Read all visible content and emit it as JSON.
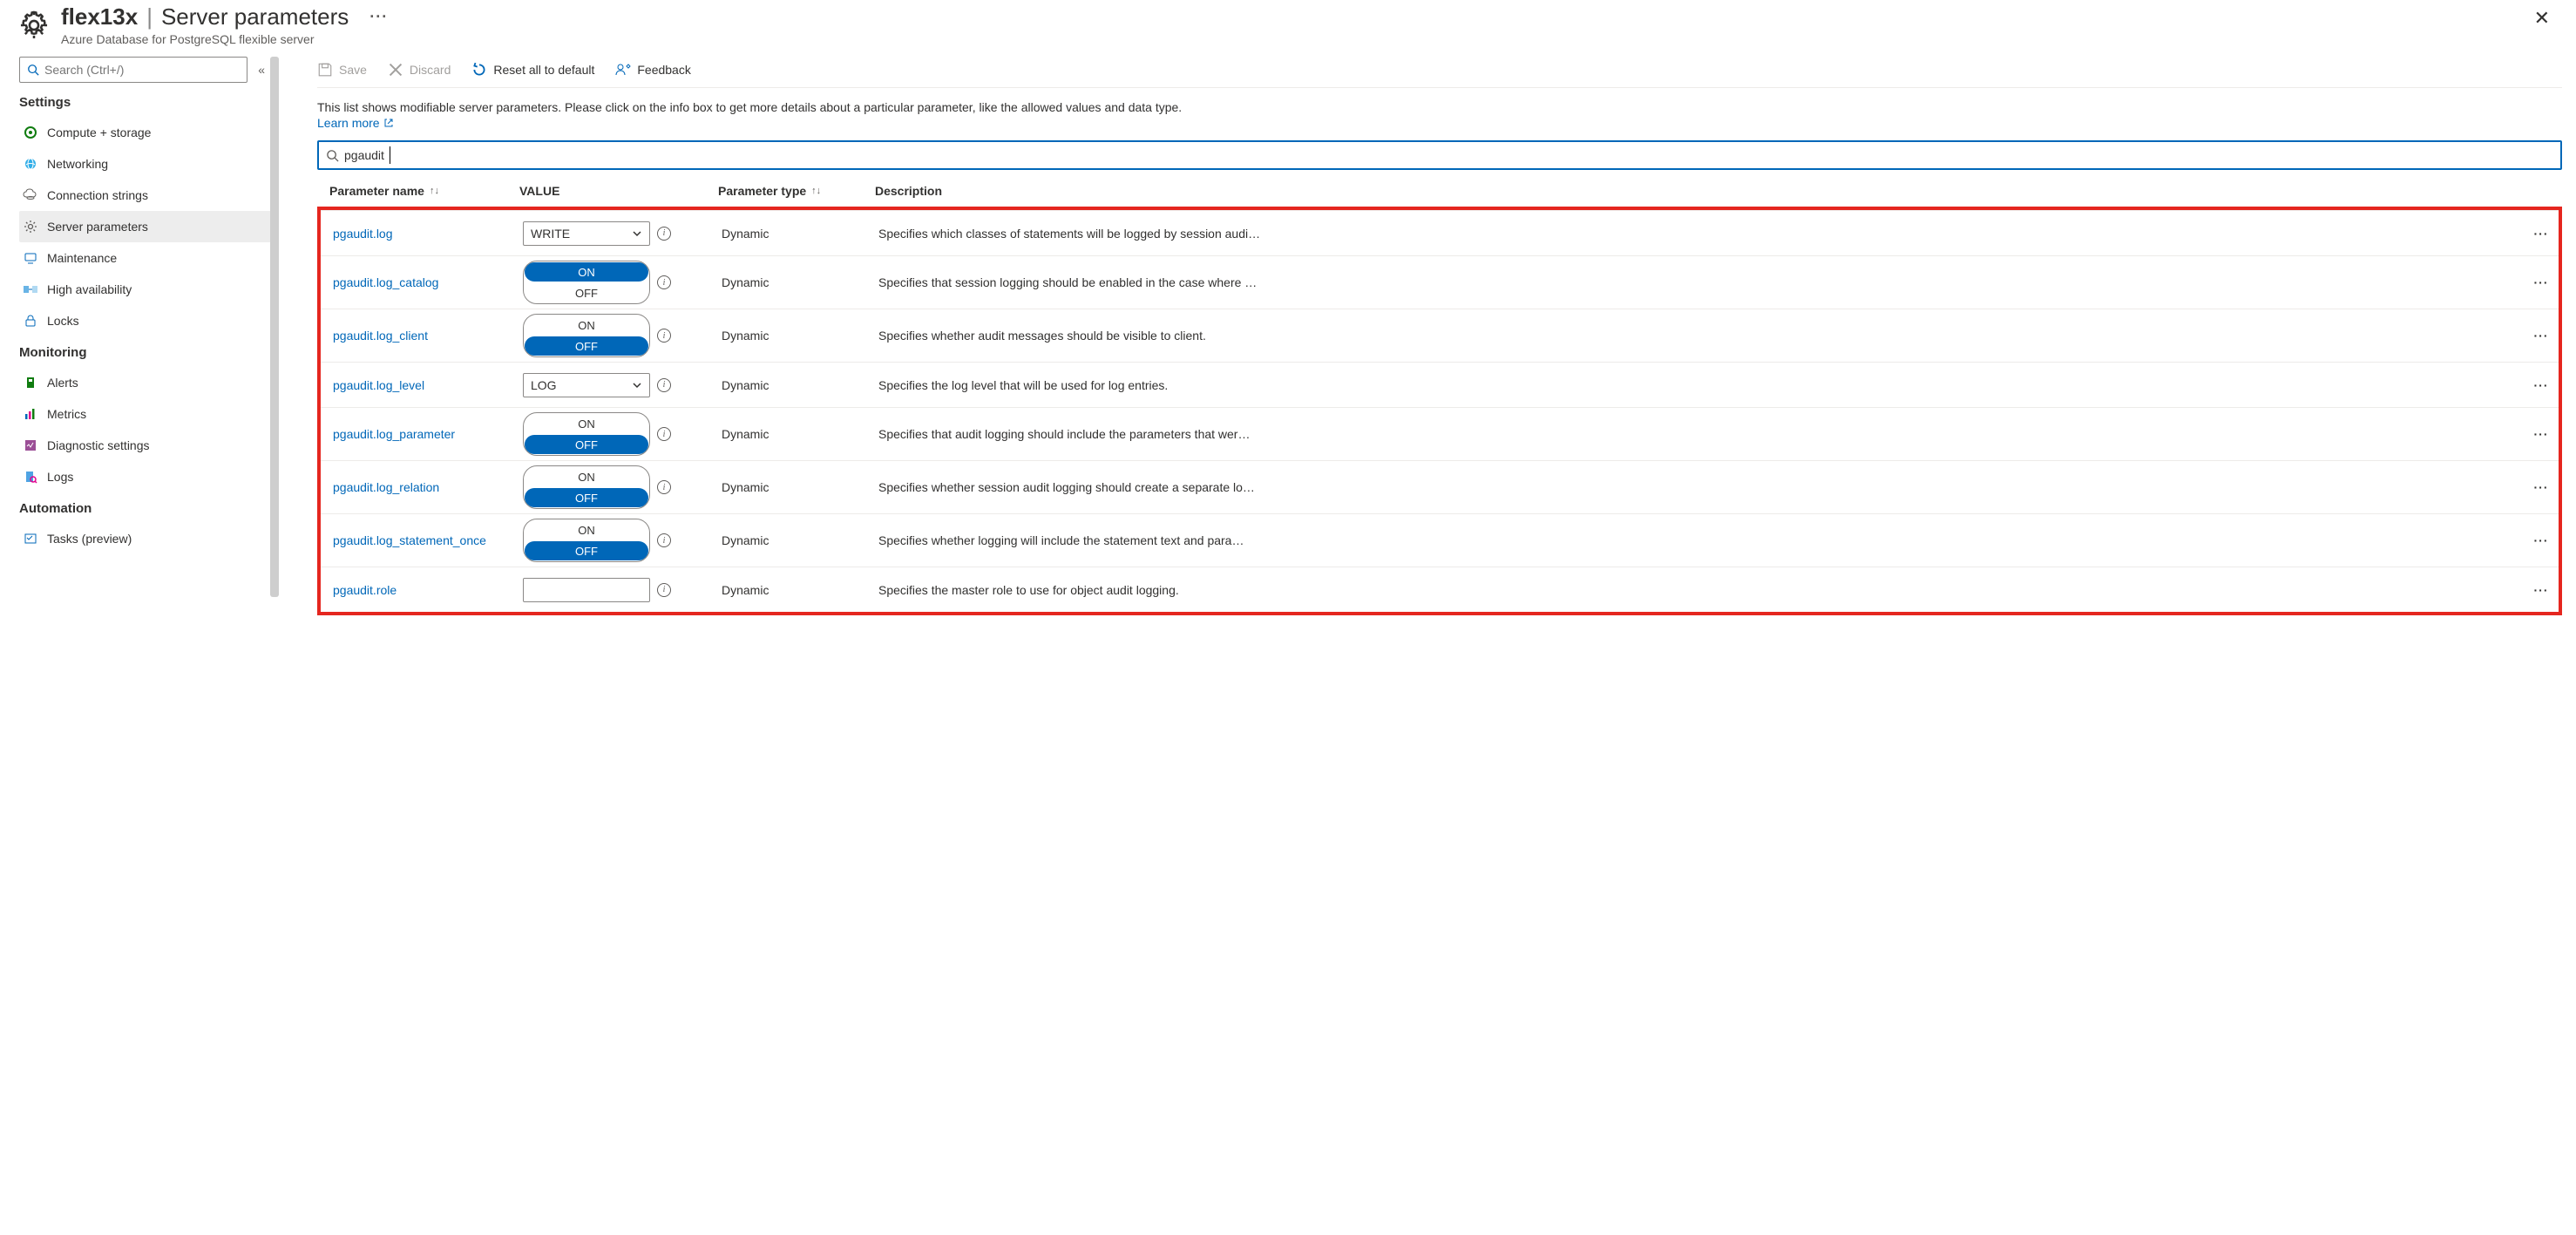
{
  "header": {
    "resource_name": "flex13x",
    "blade_name": "Server parameters",
    "subtitle": "Azure Database for PostgreSQL flexible server",
    "more": "···"
  },
  "sidebar": {
    "search_placeholder": "Search (Ctrl+/)",
    "sections": {
      "settings": "Settings",
      "monitoring": "Monitoring",
      "automation": "Automation"
    },
    "items": {
      "compute": "Compute + storage",
      "networking": "Networking",
      "connstr": "Connection strings",
      "serverparams": "Server parameters",
      "maintenance": "Maintenance",
      "ha": "High availability",
      "locks": "Locks",
      "alerts": "Alerts",
      "metrics": "Metrics",
      "diag": "Diagnostic settings",
      "logs": "Logs",
      "tasks": "Tasks (preview)"
    }
  },
  "toolbar": {
    "save": "Save",
    "discard": "Discard",
    "reset": "Reset all to default",
    "feedback": "Feedback"
  },
  "main": {
    "description": "This list shows modifiable server parameters. Please click on the info box to get more details about a particular parameter, like the allowed values and data type.",
    "learn_more": "Learn more",
    "filter_value": "pgaudit"
  },
  "columns": {
    "name": "Parameter name",
    "value": "VALUE",
    "type": "Parameter type",
    "desc": "Description"
  },
  "toggle": {
    "on": "ON",
    "off": "OFF"
  },
  "rows": [
    {
      "name": "pgaudit.log",
      "control": "select",
      "value": "WRITE",
      "type": "Dynamic",
      "desc": "Specifies which classes of statements will be logged by session audi…"
    },
    {
      "name": "pgaudit.log_catalog",
      "control": "toggle",
      "value": "ON",
      "type": "Dynamic",
      "desc": "Specifies that session logging should be enabled in the case where …"
    },
    {
      "name": "pgaudit.log_client",
      "control": "toggle",
      "value": "OFF",
      "type": "Dynamic",
      "desc": "Specifies whether audit messages should be visible to client."
    },
    {
      "name": "pgaudit.log_level",
      "control": "select",
      "value": "LOG",
      "type": "Dynamic",
      "desc": "Specifies the log level that will be used for log entries."
    },
    {
      "name": "pgaudit.log_parameter",
      "control": "toggle",
      "value": "OFF",
      "type": "Dynamic",
      "desc": "Specifies that audit logging should include the parameters that wer…"
    },
    {
      "name": "pgaudit.log_relation",
      "control": "toggle",
      "value": "OFF",
      "type": "Dynamic",
      "desc": "Specifies whether session audit logging should create a separate lo…"
    },
    {
      "name": "pgaudit.log_statement_once",
      "control": "toggle",
      "value": "OFF",
      "type": "Dynamic",
      "desc": "Specifies whether logging will include the statement text and para…"
    },
    {
      "name": "pgaudit.role",
      "control": "text",
      "value": "",
      "type": "Dynamic",
      "desc": "Specifies the master role to use for object audit logging."
    }
  ],
  "row_more": "···"
}
